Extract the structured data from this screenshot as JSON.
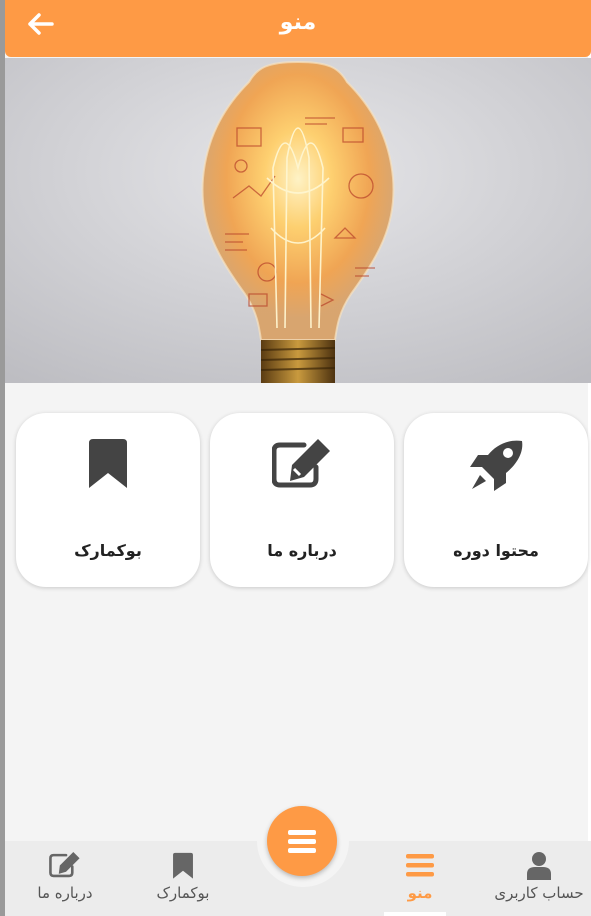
{
  "header": {
    "title": "منو",
    "back_icon": "arrow-left-icon"
  },
  "hero": {
    "image": "lightbulb-with-sketches"
  },
  "menu_cards": [
    {
      "label": "بوکمارک",
      "icon": "bookmark-icon"
    },
    {
      "label": "درباره ما",
      "icon": "edit-icon"
    },
    {
      "label": "محتوا دوره",
      "icon": "rocket-icon"
    }
  ],
  "bottom_nav": {
    "items": [
      {
        "label": "درباره ما",
        "icon": "edit-icon"
      },
      {
        "label": "بوکمارک",
        "icon": "bookmark-icon"
      },
      {
        "label": "منو",
        "icon": "menu-icon",
        "active": true
      },
      {
        "label": "حساب کاربری",
        "icon": "user-icon"
      }
    ],
    "fab_icon": "menu-icon"
  },
  "colors": {
    "accent": "#fe9a45",
    "icon_dark": "#444444",
    "nav_icon": "#666666"
  }
}
